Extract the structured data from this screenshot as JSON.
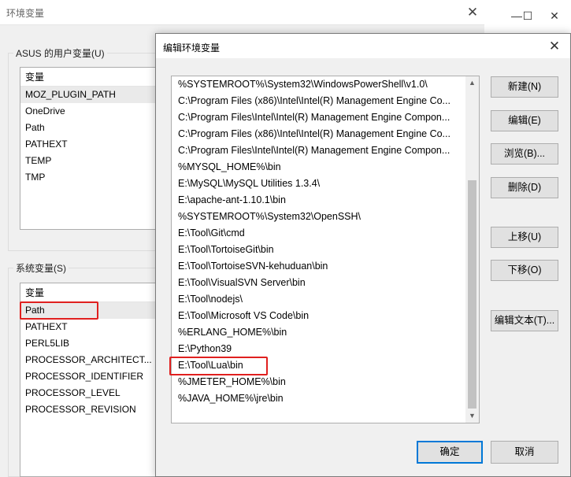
{
  "background_window": {
    "title": "环境变量",
    "close_glyph": "✕",
    "user_group": {
      "label": "ASUS 的用户变量(U)",
      "header": "变量",
      "items": [
        "MOZ_PLUGIN_PATH",
        "OneDrive",
        "Path",
        "PATHEXT",
        "TEMP",
        "TMP"
      ]
    },
    "system_group": {
      "label": "系统变量(S)",
      "header": "变量",
      "items": [
        "Path",
        "PATHEXT",
        "PERL5LIB",
        "PROCESSOR_ARCHITECT...",
        "PROCESSOR_IDENTIFIER",
        "PROCESSOR_LEVEL",
        "PROCESSOR_REVISION"
      ]
    }
  },
  "third_window": {
    "minimize_glyph": "—",
    "maximize_glyph": "☐",
    "close_glyph": "✕"
  },
  "dialog": {
    "title": "编辑环境变量",
    "close_glyph": "✕",
    "paths": [
      "%SYSTEMROOT%\\System32\\WindowsPowerShell\\v1.0\\",
      "C:\\Program Files (x86)\\Intel\\Intel(R) Management Engine Co...",
      "C:\\Program Files\\Intel\\Intel(R) Management Engine Compon...",
      "C:\\Program Files (x86)\\Intel\\Intel(R) Management Engine Co...",
      "C:\\Program Files\\Intel\\Intel(R) Management Engine Compon...",
      "%MYSQL_HOME%\\bin",
      "E:\\MySQL\\MySQL Utilities 1.3.4\\",
      "E:\\apache-ant-1.10.1\\bin",
      "%SYSTEMROOT%\\System32\\OpenSSH\\",
      "E:\\Tool\\Git\\cmd",
      "E:\\Tool\\TortoiseGit\\bin",
      "E:\\Tool\\TortoiseSVN-kehuduan\\bin",
      "E:\\Tool\\VisualSVN Server\\bin",
      "E:\\Tool\\nodejs\\",
      "E:\\Tool\\Microsoft VS Code\\bin",
      "%ERLANG_HOME%\\bin",
      "E:\\Python39",
      "E:\\Tool\\Lua\\bin",
      "%JMETER_HOME%\\bin",
      "%JAVA_HOME%\\jre\\bin"
    ],
    "highlighted_path": "E:\\Tool\\Lua\\bin",
    "buttons": {
      "new": "新建(N)",
      "edit": "编辑(E)",
      "browse": "浏览(B)...",
      "delete": "删除(D)",
      "move_up": "上移(U)",
      "move_down": "下移(O)",
      "edit_text": "编辑文本(T)...",
      "ok": "确定",
      "cancel": "取消"
    },
    "scroll_up_glyph": "▲",
    "scroll_down_glyph": "▼"
  },
  "colors": {
    "highlight_border": "#e0201f",
    "primary_button_border": "#0078d7"
  }
}
